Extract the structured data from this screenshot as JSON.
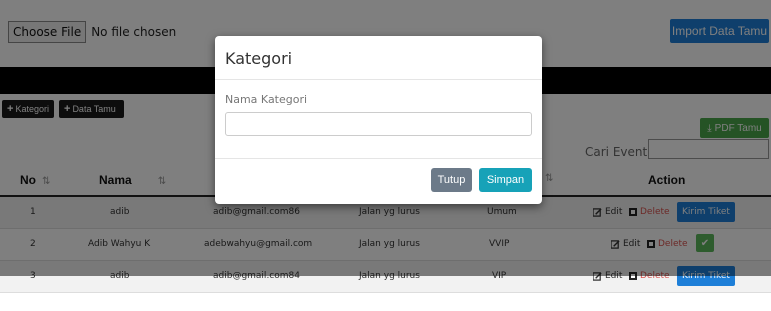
{
  "file_input": {
    "button_label": "Choose File",
    "status": "No file chosen"
  },
  "import_button": "Import Data Tamu",
  "toolbar": {
    "kategori_label": "Kategori",
    "data_tamu_label": "Data Tamu",
    "pdf_label": "PDF Tamu"
  },
  "search": {
    "label": "Cari Event:",
    "value": ""
  },
  "table": {
    "headers": {
      "no": "No",
      "nama": "Nama",
      "action": "Action"
    },
    "rows": [
      {
        "no": "1",
        "nama": "adib",
        "email": "adib@gmail.com86",
        "alamat": "Jalan yg lurus",
        "kategori": "Umum",
        "edit": "Edit",
        "delete": "Delete",
        "kirim": "Kirim Tiket"
      },
      {
        "no": "2",
        "nama": "Adib Wahyu K",
        "email": "adebwahyu@gmail.com",
        "alamat": "Jalan yg lurus",
        "kategori": "VVIP",
        "edit": "Edit",
        "delete": "Delete"
      },
      {
        "no": "3",
        "nama": "adib",
        "email": "adib@gmail.com84",
        "alamat": "Jalan yg lurus",
        "kategori": "VIP",
        "edit": "Edit",
        "delete": "Delete",
        "kirim": "Kirim Tiket"
      }
    ]
  },
  "modal": {
    "title": "Kategori",
    "field_label": "Nama Kategori",
    "field_value": "",
    "cancel_label": "Tutup",
    "save_label": "Simpan"
  },
  "icons": {
    "edit": "edit-icon",
    "delete": "delete-icon",
    "check": "check-icon",
    "download": "download-icon",
    "plus": "plus-icon"
  }
}
